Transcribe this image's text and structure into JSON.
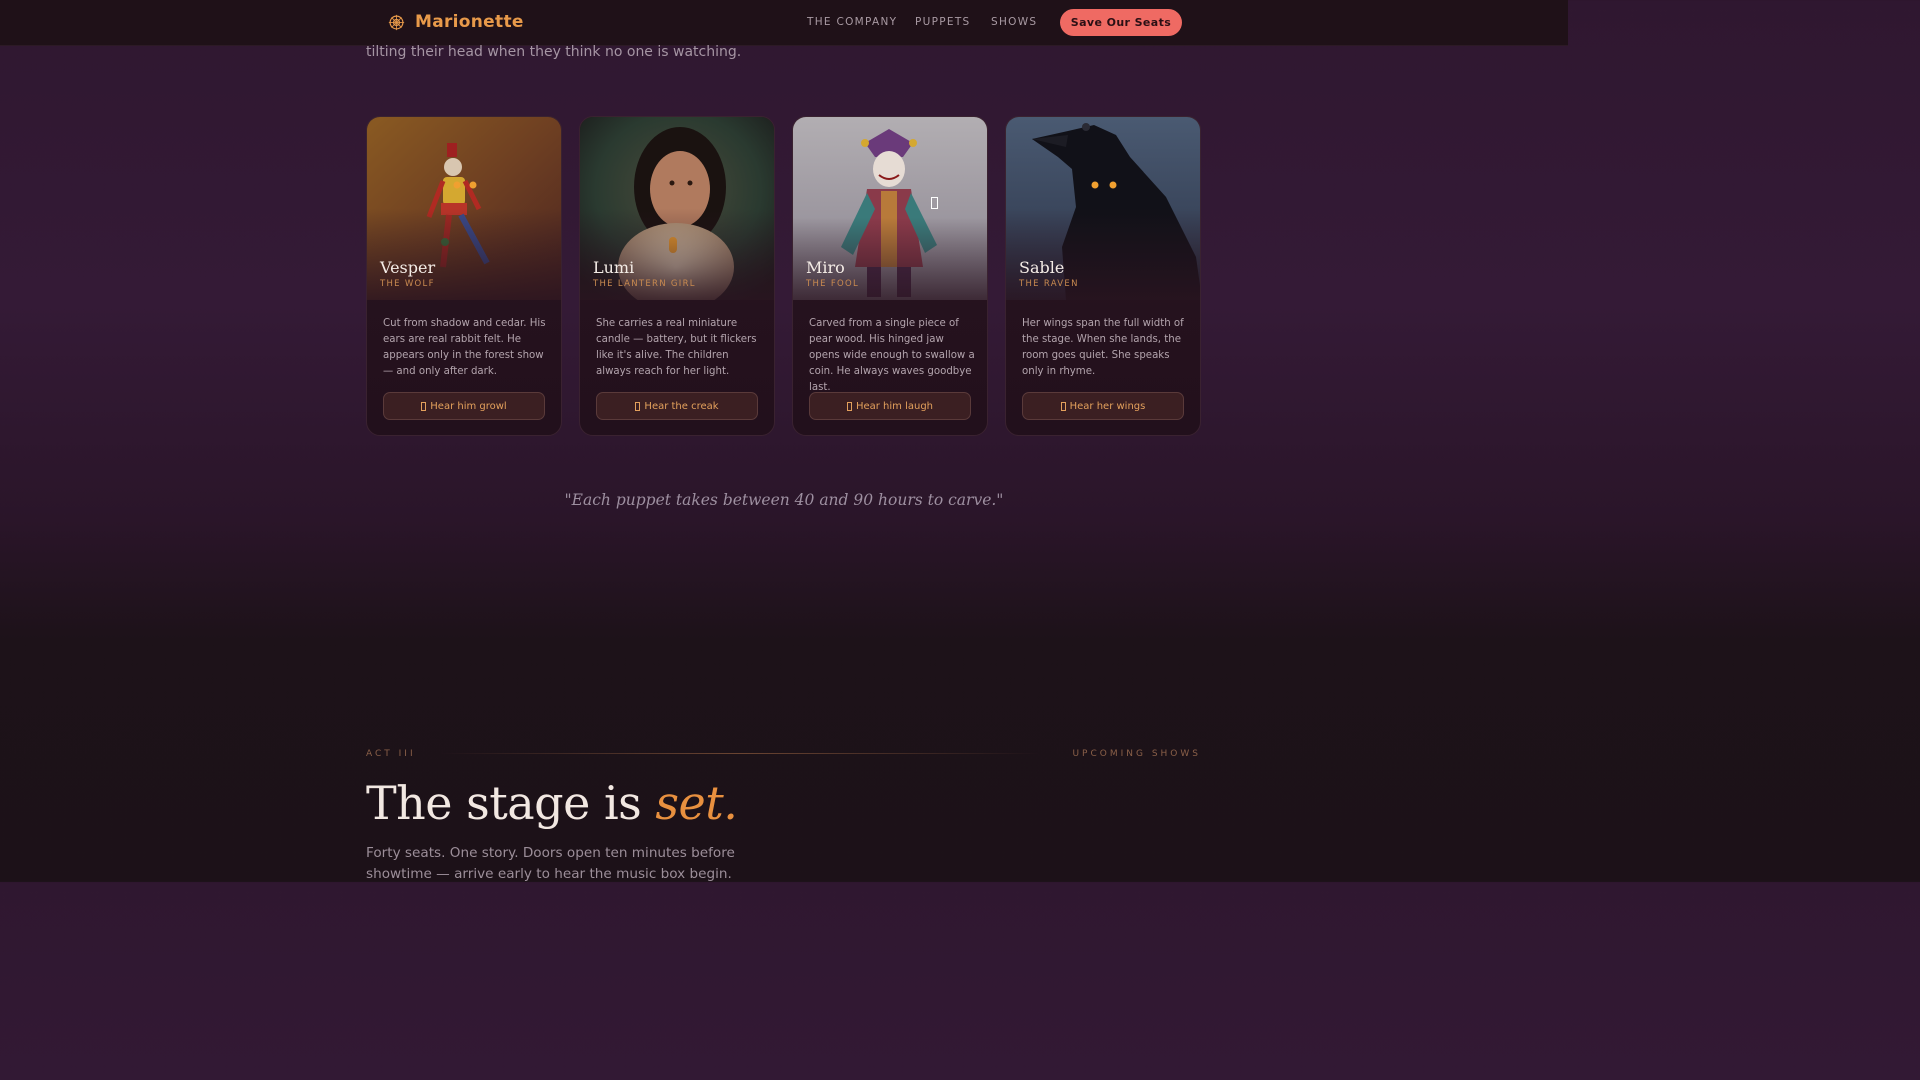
{
  "nav": {
    "brand": "Marionette",
    "links": [
      "THE COMPANY",
      "PUPPETS",
      "SHOWS"
    ],
    "cta": "Save Our Seats"
  },
  "intro_tail": "tilting their head when they think no one is watching.",
  "puppets": [
    {
      "name": "Vesper",
      "role": "THE WOLF",
      "description": "Cut from shadow and cedar. His ears are real rabbit felt. He appears only in the forest show — and only after dark.",
      "button": "Hear him growl"
    },
    {
      "name": "Lumi",
      "role": "THE LANTERN GIRL",
      "description": "She carries a real miniature candle — battery, but it flickers like it's alive. The children always reach for her light.",
      "button": "Hear the creak"
    },
    {
      "name": "Miro",
      "role": "THE FOOL",
      "description": "Carved from a single piece of pear wood. His hinged jaw opens wide enough to swallow a coin. He always waves goodbye last.",
      "button": "Hear him laugh"
    },
    {
      "name": "Sable",
      "role": "THE RAVEN",
      "description": "Her wings span the full width of the stage. When she lands, the room goes quiet. She speaks only in rhyme.",
      "button": "Hear her wings"
    }
  ],
  "quote": "\"Each puppet takes between 40 and 90 hours to carve.\"",
  "act": {
    "label": "ACT III",
    "right_label": "UPCOMING SHOWS",
    "headline_start": "The stage is ",
    "headline_em": "set.",
    "sub": "Forty seats. One story. Doors open ten minutes before showtime — arrive early to hear the music box begin."
  },
  "colors": {
    "accent": "#e8903f",
    "cta": "#ef6a63",
    "background": "#2f1730"
  }
}
